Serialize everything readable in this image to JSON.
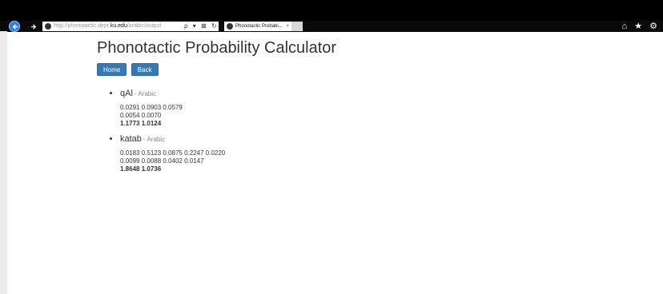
{
  "browser": {
    "address_prefix": "http://phonotactic.dept.",
    "address_domain": "ku.edu",
    "address_suffix": "/arabic/output",
    "address_actions": "ρ ▾ ⊠ ↻",
    "tab_title": "Phonotactic Probabi...",
    "tab_close": "×",
    "right_icons": "⌂ ★ ⚙"
  },
  "page": {
    "title": "Phonotactic Probability Calculator",
    "buttons": {
      "home": "Home",
      "back": "Back"
    }
  },
  "results": [
    {
      "word": "qAl",
      "language": "- Arabic",
      "line1": "0.0291 0.0903 0.0579",
      "line2": "0.0054 0.0070",
      "sum": "1.1773 1.0124"
    },
    {
      "word": "katab",
      "language": "- Arabic",
      "line1": "0.0183 0.5123 0.0875 0.2247 0.0220",
      "line2": "0.0099 0.0088 0.0402 0.0147",
      "sum": "1.8648 1.0736"
    }
  ],
  "colors": {
    "button_bg": "#337ab7",
    "back_button": "#2b7de9"
  },
  "icons": [
    "back-arrow-icon",
    "forward-arrow-icon",
    "site-icon",
    "search-icon",
    "home-icon",
    "star-icon",
    "gear-icon"
  ]
}
